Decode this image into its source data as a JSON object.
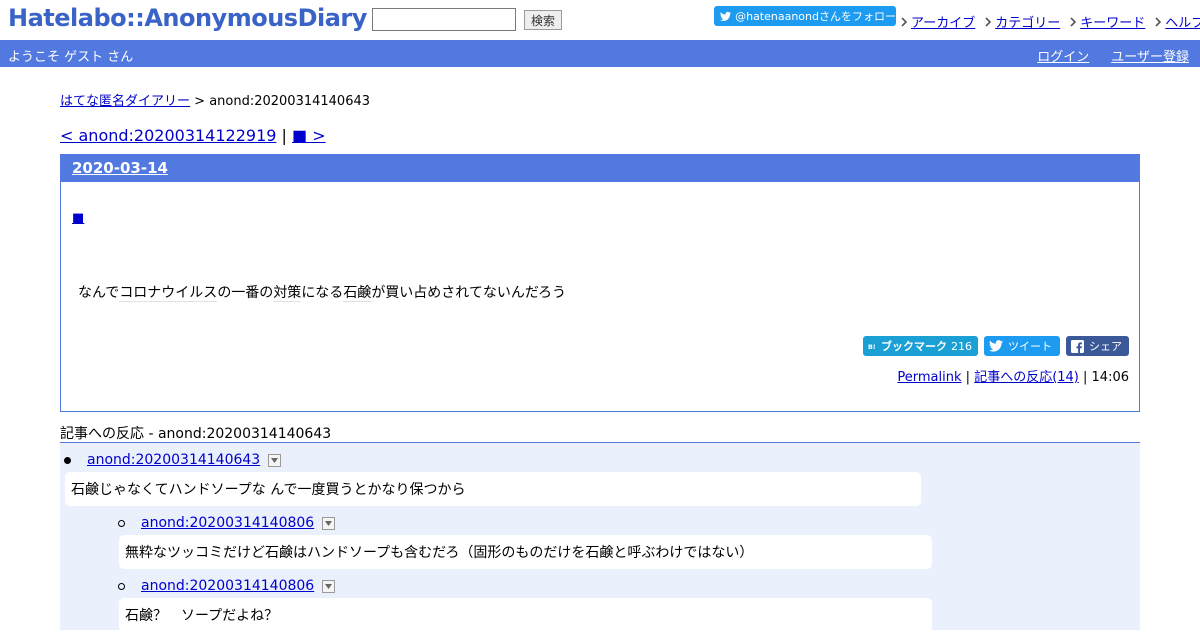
{
  "header": {
    "logo_text": "Hatelabo::AnonymousDiary",
    "search_placeholder": "",
    "search_button": "検索",
    "twitter_follow": "@hatenaanondさんをフォロー",
    "links": [
      "アーカイブ",
      "カテゴリー",
      "キーワード",
      "ヘルプ"
    ]
  },
  "bar": {
    "welcome": "ようこそ ゲスト さん",
    "login": "ログイン",
    "register": "ユーザー登録"
  },
  "breadcrumb": {
    "home": "はてな匿名ダイアリー",
    "separator": " > ",
    "current": "anond:20200314140643"
  },
  "pager": {
    "prev": "< anond:20200314122919",
    "separator": " | ",
    "next": "■ >"
  },
  "entry": {
    "date": "2020-03-14",
    "square_link": "■",
    "body_parts": [
      "なんで",
      "コロナウイルス",
      "の一番の",
      "対策",
      "になる",
      "石鹸",
      "が買い占めされてないんだろう"
    ],
    "share": {
      "bookmark_label": "ブックマーク",
      "bookmark_count": "216",
      "tweet": "ツイート",
      "facebook": "シェア"
    },
    "meta": {
      "permalink": "Permalink",
      "sep1": " | ",
      "reactions": "記事への反応(14)",
      "sep2": " | ",
      "time": "14:06"
    }
  },
  "refs": {
    "title": "記事への反応 - anond:20200314140643",
    "items": [
      {
        "id": "anond:20200314140643",
        "text": "石鹸じゃなくてハンドソープな んで一度買うとかなり保つから"
      },
      {
        "id": "anond:20200314140806",
        "text": "無粋なツッコミだけど石鹸はハンドソープも含むだろ（固形のものだけを石鹸と呼ぶわけではない）"
      },
      {
        "id": "anond:20200314140806",
        "text": "石鹸？　ソープだよね？"
      }
    ]
  },
  "colors": {
    "brand_blue": "#5179e0",
    "link": "#0000cc",
    "refs_bg": "#eaf0fc",
    "twitter": "#1d9bf0",
    "hatena_bookmark": "#1ba0d6",
    "facebook": "#3b5998"
  },
  "icons": {
    "twitter": "twitter-bird-icon",
    "chevron": "chevron-right-icon",
    "dropdown": "triangle-down-icon",
    "bookmark": "hatena-bookmark-icon",
    "facebook": "facebook-f-icon"
  }
}
